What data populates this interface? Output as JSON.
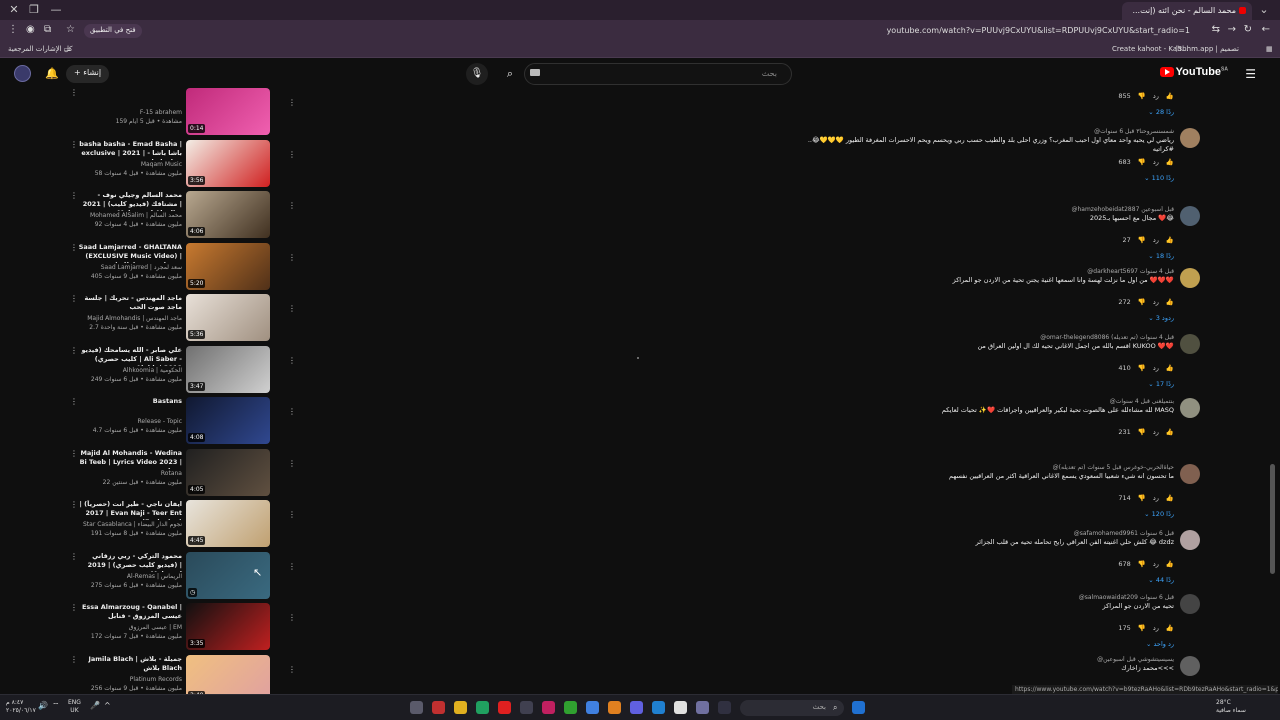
{
  "browser": {
    "tab_title": "محمد السالم - نحن ائته (إنت...",
    "address": "youtube.com/watch?v=PUUvj9CxUYU&list=RDPUUvj9CxUYU&start_radio=1",
    "open_in_app": "فتح في التطبيق",
    "bookmarks": {
      "all_bookmarks": "كل الإشارات المرجعية",
      "create_kahoot": "Create kahoot - Kah...",
      "tbhm": "(3bhm.app | تصميم"
    }
  },
  "youtube": {
    "logo_text": "YouTube",
    "logo_country": "SA",
    "search_placeholder": "بحث",
    "create_label": "إنشاء"
  },
  "playlist": [
    {
      "title": "",
      "channel": "F-15 abrahem",
      "meta": "159 مشاهدة • قبل 5 أيام",
      "duration": "0:14",
      "color1": "#c02a7a",
      "color2": "#f060b0"
    },
    {
      "title": "basha basha - Emad Basha | exclusive | 2021 | باشا باشا - عماد باشا",
      "channel": "Maqam Music",
      "meta": "58 مليون مشاهدة • قبل 4 سنوات",
      "duration": "3:56",
      "color1": "#f3eee6",
      "color2": "#d02020"
    },
    {
      "title": "محمد السالم وجيلي نوف - مشتاقك (فيديو كليب) | 2021 | Mohamed Alsalim",
      "channel": "Mohamed AlSalim | محمد السالم",
      "meta": "92 مليون مشاهدة • قبل 4 سنوات",
      "duration": "4:06",
      "color1": "#b8a890",
      "color2": "#403020"
    },
    {
      "title": "Saad Lamjarred - GHALTANA (EXCLUSIVE Music Video) | (سعد لمجرد - غلطانة",
      "channel": "Saad Lamjarred | سعد لمجرد",
      "meta": "405 مليون مشاهدة • قبل 9 سنوات",
      "duration": "5:20",
      "color1": "#c87a30",
      "color2": "#503018"
    },
    {
      "title": "ماجد المهندس - تحريك | جلسة ماجد صوت الحب",
      "channel": "Majid Almohandis | ماجد المهندس",
      "meta": "2.7 مليون مشاهدة • قبل سنة واحدة",
      "duration": "5:36",
      "color1": "#e8e0d8",
      "color2": "#a09080"
    },
    {
      "title": "علي صابر - الله يسامحك (فيديو كليب حصري) | Ali Saber - Alahh | 2019",
      "channel": "Alhkoomia | الحكومية",
      "meta": "249 مليون مشاهدة • قبل 6 سنوات",
      "duration": "3:47",
      "color1": "#707070",
      "color2": "#d0d0d0"
    },
    {
      "title": "Bastans",
      "channel": "Release - Topic",
      "meta": "4.7 مليون مشاهدة • قبل 6 سنوات",
      "duration": "4:08",
      "color1": "#101830",
      "color2": "#304890"
    },
    {
      "title": "Majid Al Mohandis - Wedina Bi Teeb | Lyrics Video 2023 | ماجد...",
      "channel": "Rotana",
      "meta": "22 مليون مشاهدة • قبل سنتين",
      "duration": "4:05",
      "color1": "#202020",
      "color2": "#605040"
    },
    {
      "title": "ايفان ناجي - طير انت (حصرياً) | 2017 | Evan Naji - Teer Ent (Exclusive)",
      "channel": "Star Casablanca | نجوم الدار البيضاء",
      "meta": "191 مليون مشاهدة • قبل 8 سنوات",
      "duration": "4:45",
      "color1": "#e8e4dc",
      "color2": "#c0a070"
    },
    {
      "title": "محمود التركي - ربي رزقاني (فيديو كليب حصري) | 2019 | Mahmod",
      "channel": "Al-Remas | الريماس",
      "meta": "275 مليون مشاهدة • قبل 6 سنوات",
      "duration": "",
      "color1": "#2a4a5a",
      "color2": "#3a6a80"
    },
    {
      "title": "Essa Almarzoug - Qanabel | عيسى المرزوق - قنابل",
      "channel": "عيسى المرزوق | EM",
      "meta": "172 مليون مشاهدة • قبل 7 سنوات",
      "duration": "3:35",
      "color1": "#101010",
      "color2": "#c02020"
    },
    {
      "title": "Jamila Blach | جميلة - بلاش بلاش Blach",
      "channel": "Platinum Records",
      "meta": "256 مليون مشاهدة • قبل 9 سنوات",
      "duration": "3:40",
      "color1": "#f0c080",
      "color2": "#e0a0a0"
    }
  ],
  "comments": [
    {
      "header": "",
      "text": "",
      "likes": "855",
      "replies": "28 ردًا",
      "avatar_color": "#000000"
    },
    {
      "header": "@شمسنسروحنا٣ قبل 6 سنوات",
      "text": "..رياضي لي يحبه واحد معاي اول احبب المغرب؟ وزري احلى بلد والطيب حسب ربي ويحسم ويحم الاحسرات المغرفة الطيور 💛💛💛😂 #كراتيه",
      "likes": "683",
      "replies": "110 ردًا",
      "avatar_color": "#a08060"
    },
    {
      "header": "@hamzehobeidat2887 قبل أسبوعين",
      "text": "مجال مع احسبها بـ2025 ❤️😂",
      "likes": "27",
      "replies": "18 ردًا",
      "avatar_color": "#506070"
    },
    {
      "header": "@darkheart5697 قبل 4 سنوات",
      "text": "من اول ما نزلت لهسة وانا اسمعها اغنية يجنن تحية من الاردن جو المراكز ❤️❤️❤️",
      "likes": "272",
      "replies": "3 ردود",
      "avatar_color": "#c0a050"
    },
    {
      "header": "@omar-thelegend8086 قبل 4 سنوات (تم تعديله)",
      "text": "اقسم بالله من اجمل الاغاني تحيه لك ال اولين العراق من KUKOO ❤️❤️",
      "likes": "410",
      "replies": "17 ردًا",
      "avatar_color": "#505040"
    },
    {
      "header": "@بنتميلغنى قبل 4 سنوات",
      "text": "لله مشاءلله على هالصوت تحية لبكير والعراقيين واجراقات ❤️✨ تحيات لعايكم MASQ",
      "likes": "231",
      "replies": "",
      "avatar_color": "#909080"
    },
    {
      "header": "@حياةالحربي-خوغرس قبل 5 سنوات (تم تعديله)",
      "text": "ما تحسون انه شيء شعبيا السعودي يسمع الاغاني العراقية اكثر من العراقيين نفسهم",
      "likes": "714",
      "replies": "120 ردًا",
      "avatar_color": "#806050"
    },
    {
      "header": "@safamohamed9961 قبل 6 سنوات",
      "text": "كلش حلي اغنيته الفن العراقي رايح تحامله تحيه من قلب الجزائر 😂 dzdz",
      "likes": "678",
      "replies": "44 ردًا",
      "avatar_color": "#b0a0a0"
    },
    {
      "header": "@salmaowaidat209 قبل 6 سنوات",
      "text": "تحيه من الاردن جو المراكز",
      "likes": "175",
      "replies": "رد واحد",
      "avatar_color": "#444444"
    },
    {
      "header": "@يسيسيتشوشي قبل أسبوعين",
      "text": "محمد زاخارك<<<",
      "likes": "",
      "replies": "",
      "avatar_color": "#606060"
    }
  ],
  "status_url": "https://www.youtube.com/watch?v=b9tezRaAHo&list=RDb9tezRaAHo&start_radio=1&pp=oAcB",
  "taskbar": {
    "search_placeholder": "بحث",
    "weather_temp": "28°C",
    "weather_desc": "سماء صافية",
    "lang_top": "ENG",
    "lang_bottom": "UK",
    "clock_time": "٨:٤٧ م",
    "clock_date": "٢٠٢٥/٠٦/١٧"
  }
}
